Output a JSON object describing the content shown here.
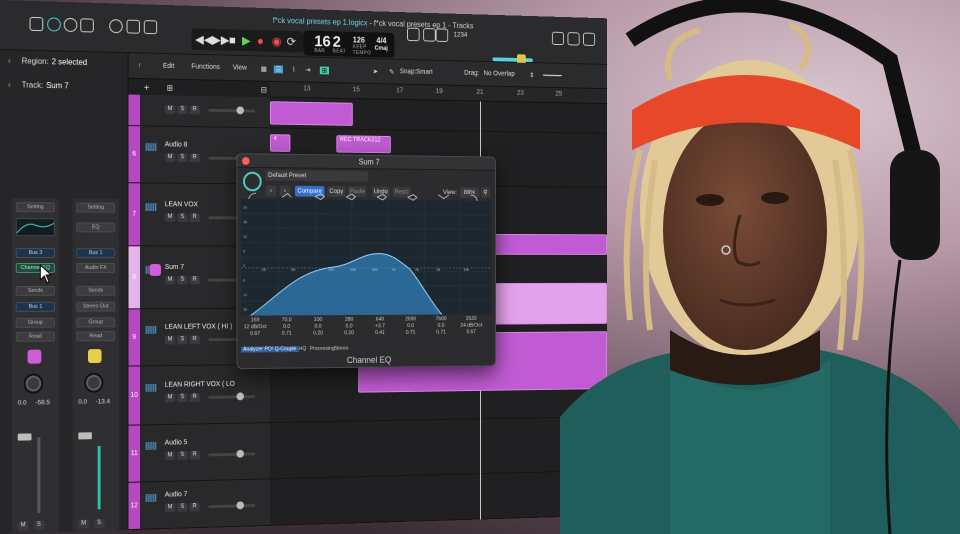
{
  "window": {
    "title_file": "f*ck vocal presets ep 1.logicx",
    "title_rest": " - f*ck vocal presets ep 1 - Tracks"
  },
  "lcd": {
    "bar": "16",
    "beat": "2",
    "bar_label": "BAR",
    "beat_label": "BEAT",
    "tempo": "126",
    "keep_label": "KEEP",
    "tempo_label": "TEMPO",
    "sig": "4/4",
    "key": "Cmaj",
    "count": "1234"
  },
  "inspector": {
    "region": "Region:",
    "region_value": "2 selected",
    "track": "Track:",
    "track_value": "Sum 7",
    "strips": [
      {
        "setting": "Setting",
        "eq": "",
        "bus": "Bus 3",
        "insert": "Channel EQ",
        "sends": "Sends",
        "output": "Bus 1",
        "group": "Group",
        "read": "Read",
        "v1": "0.0",
        "v2": "-58.5",
        "m": "M",
        "s": "S",
        "color": "#d15ed9"
      },
      {
        "setting": "Setting",
        "eq": "EQ",
        "bus": "Bus 1",
        "insert": "Audio FX",
        "sends": "Sends",
        "output": "Stereo Out",
        "group": "Group",
        "read": "Read",
        "v1": "0.0",
        "v2": "-13.4",
        "m": "M",
        "s": "S",
        "color": "#e8d04a"
      }
    ]
  },
  "toolbar": {
    "edit": "Edit",
    "functions": "Functions",
    "view": "View",
    "snap_label": "Snap:",
    "snap_value": "Smart",
    "drag_label": "Drag:",
    "drag_value": "No Overlap"
  },
  "ruler": [
    "13",
    "15",
    "17",
    "19",
    "21",
    "23",
    "25"
  ],
  "tracks": [
    {
      "num": "",
      "name": "",
      "m": "M",
      "s": "S",
      "r": "R"
    },
    {
      "num": "6",
      "name": "Audio 8",
      "m": "M",
      "s": "S",
      "r": "R"
    },
    {
      "num": "7",
      "name": "LEAN VOX",
      "m": "M",
      "s": "S",
      "r": "R"
    },
    {
      "num": "8",
      "name": "Sum 7",
      "m": "M",
      "s": "S",
      "r": "R"
    },
    {
      "num": "9",
      "name": "LEAN LEFT VOX ( HI )",
      "m": "M",
      "s": "S",
      "r": "R"
    },
    {
      "num": "10",
      "name": "LEAN RIGHT VOX ( LO",
      "m": "M",
      "s": "S",
      "r": "R"
    },
    {
      "num": "11",
      "name": "Audio 5",
      "m": "M",
      "s": "S",
      "r": "R"
    },
    {
      "num": "12",
      "name": "Audio 7",
      "m": "M",
      "s": "S",
      "r": "R"
    }
  ],
  "regions": {
    "rec": "REC TRACK#12",
    "four": "4"
  },
  "eq": {
    "title": "Sum 7",
    "preset": "Default Preset",
    "compare": "Compare",
    "copy": "Copy",
    "paste": "Paste",
    "undo": "Undo",
    "redo": "Redo",
    "view_label": "View:",
    "view_value": "89%",
    "bands": [
      {
        "f": "169",
        "g": "12 dB/Oct",
        "q": "0.67"
      },
      {
        "f": "70.0",
        "g": "0.0",
        "q": "0.71"
      },
      {
        "f": "100",
        "g": "0.0",
        "q": "0.20"
      },
      {
        "f": "280",
        "g": "0.0",
        "q": "0.20"
      },
      {
        "f": "640",
        "g": "+3.7",
        "q": "0.41"
      },
      {
        "f": "2090",
        "g": "0.0",
        "q": "0.71"
      },
      {
        "f": "7600",
        "g": "0.0",
        "q": "0.71"
      },
      {
        "f": "2520",
        "g": "24 dB/Oct",
        "q": "0.67"
      }
    ],
    "analyzer": "Analyzer",
    "post": "POST",
    "qcouple": "Q-Couple",
    "hq": "HQ",
    "processing": "Processing",
    "stereo": "Stereo",
    "name": "Channel EQ",
    "freq_labels": [
      "20",
      "50",
      "100",
      "200",
      "500",
      "1k",
      "2k",
      "5k",
      "10k"
    ],
    "db_labels": [
      "+24",
      "+18",
      "+12",
      "+6",
      "0",
      "-6",
      "-12",
      "-18",
      "-24"
    ]
  },
  "colors": {
    "accent": "#4dd1d1",
    "region": "#c05bd3",
    "track_stripe": "#b649c2"
  }
}
